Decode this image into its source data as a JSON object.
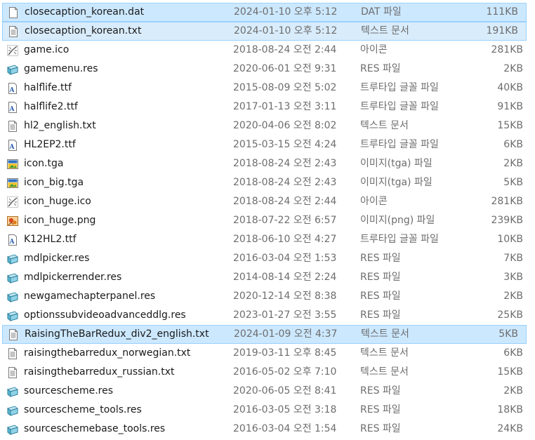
{
  "files": [
    {
      "name": "closecaption_korean.dat",
      "date": "2024-01-10 오후 5:12",
      "type": "DAT 파일",
      "size": "111KB",
      "icon": "document-icon",
      "selected": true
    },
    {
      "name": "closecaption_korean.txt",
      "date": "2024-01-10 오후 5:12",
      "type": "텍스트 문서",
      "size": "191KB",
      "icon": "text-document-icon",
      "selected": true,
      "focused": true
    },
    {
      "name": "game.ico",
      "date": "2018-08-24 오전 2:44",
      "type": "아이콘",
      "size": "281KB",
      "icon": "ico-icon"
    },
    {
      "name": "gamemenu.res",
      "date": "2020-06-01 오전 9:31",
      "type": "RES 파일",
      "size": "2KB",
      "icon": "res-icon"
    },
    {
      "name": "halflife.ttf",
      "date": "2015-08-09 오전 5:02",
      "type": "트루타입 글꼴 파일",
      "size": "40KB",
      "icon": "font-icon"
    },
    {
      "name": "halflife2.ttf",
      "date": "2017-01-13 오전 3:11",
      "type": "트루타입 글꼴 파일",
      "size": "91KB",
      "icon": "font-icon"
    },
    {
      "name": "hl2_english.txt",
      "date": "2020-04-06 오전 8:02",
      "type": "텍스트 문서",
      "size": "15KB",
      "icon": "text-document-icon"
    },
    {
      "name": "HL2EP2.ttf",
      "date": "2015-03-15 오전 4:24",
      "type": "트루타입 글꼴 파일",
      "size": "6KB",
      "icon": "font-icon"
    },
    {
      "name": "icon.tga",
      "date": "2018-08-24 오전 2:43",
      "type": "이미지(tga) 파일",
      "size": "2KB",
      "icon": "tga-icon"
    },
    {
      "name": "icon_big.tga",
      "date": "2018-08-24 오전 2:43",
      "type": "이미지(tga) 파일",
      "size": "5KB",
      "icon": "tga-icon"
    },
    {
      "name": "icon_huge.ico",
      "date": "2018-08-24 오전 2:44",
      "type": "아이콘",
      "size": "281KB",
      "icon": "ico-icon"
    },
    {
      "name": "icon_huge.png",
      "date": "2018-07-22 오전 6:57",
      "type": "이미지(png) 파일",
      "size": "239KB",
      "icon": "png-icon"
    },
    {
      "name": "K12HL2.ttf",
      "date": "2018-06-10 오전 4:27",
      "type": "트루타입 글꼴 파일",
      "size": "10KB",
      "icon": "font-icon"
    },
    {
      "name": "mdlpicker.res",
      "date": "2016-03-04 오전 1:53",
      "type": "RES 파일",
      "size": "7KB",
      "icon": "res-icon"
    },
    {
      "name": "mdlpickerrender.res",
      "date": "2014-08-14 오전 2:24",
      "type": "RES 파일",
      "size": "3KB",
      "icon": "res-icon"
    },
    {
      "name": "newgamechapterpanel.res",
      "date": "2020-12-14 오전 8:38",
      "type": "RES 파일",
      "size": "2KB",
      "icon": "res-icon"
    },
    {
      "name": "optionssubvideoadvanceddlg.res",
      "date": "2023-01-27 오전 3:55",
      "type": "RES 파일",
      "size": "25KB",
      "icon": "res-icon"
    },
    {
      "name": "RaisingTheBarRedux_div2_english.txt",
      "date": "2024-01-09 오전 4:37",
      "type": "텍스트 문서",
      "size": "5KB",
      "icon": "text-document-icon",
      "selected": true
    },
    {
      "name": "raisingthebarredux_norwegian.txt",
      "date": "2019-03-11 오후 8:45",
      "type": "텍스트 문서",
      "size": "6KB",
      "icon": "text-document-icon"
    },
    {
      "name": "raisingthebarredux_russian.txt",
      "date": "2016-05-02 오후 7:10",
      "type": "텍스트 문서",
      "size": "15KB",
      "icon": "text-document-icon"
    },
    {
      "name": "sourcescheme.res",
      "date": "2020-06-05 오전 8:41",
      "type": "RES 파일",
      "size": "2KB",
      "icon": "res-icon"
    },
    {
      "name": "sourcescheme_tools.res",
      "date": "2016-03-05 오전 3:18",
      "type": "RES 파일",
      "size": "18KB",
      "icon": "res-icon"
    },
    {
      "name": "sourceschemebase_tools.res",
      "date": "2016-03-04 오전 1:54",
      "type": "RES 파일",
      "size": "24KB",
      "icon": "res-icon"
    }
  ]
}
